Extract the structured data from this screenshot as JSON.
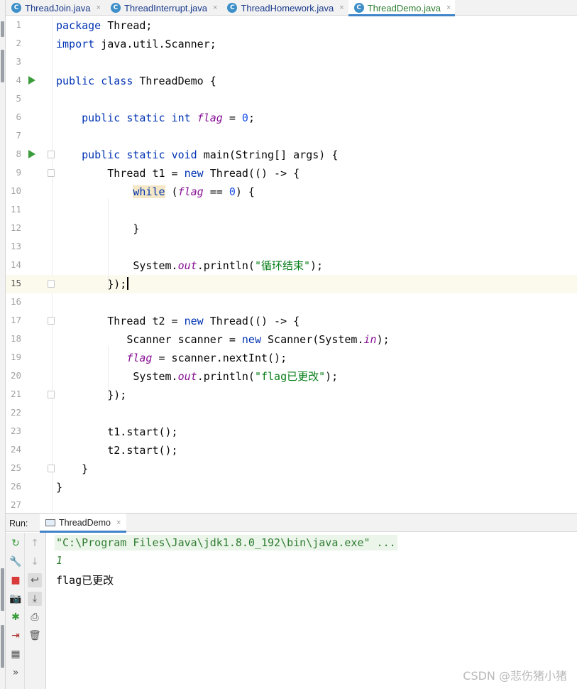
{
  "tabs": [
    {
      "name": "ThreadJoin.java",
      "active": false
    },
    {
      "name": "ThreadInterrupt.java",
      "active": false
    },
    {
      "name": "ThreadHomework.java",
      "active": false
    },
    {
      "name": "ThreadDemo.java",
      "active": true
    }
  ],
  "tab_file_icon": "C",
  "tab_close_glyph": "×",
  "editor": {
    "current_line": 15,
    "run_gutter_lines": [
      4,
      8
    ],
    "fold_marker_lines": [
      8,
      9,
      15,
      17,
      21,
      25
    ],
    "lines": [
      {
        "no": "1",
        "text": "package Thread;"
      },
      {
        "no": "2",
        "text": "import java.util.Scanner;"
      },
      {
        "no": "3",
        "text": ""
      },
      {
        "no": "4",
        "text": "public class ThreadDemo {"
      },
      {
        "no": "5",
        "text": ""
      },
      {
        "no": "6",
        "text": "    public static int flag = 0;"
      },
      {
        "no": "7",
        "text": ""
      },
      {
        "no": "8",
        "text": "    public static void main(String[] args) {"
      },
      {
        "no": "9",
        "text": "        Thread t1 = new Thread(() -> {"
      },
      {
        "no": "10",
        "text": "            while (flag == 0) {"
      },
      {
        "no": "11",
        "text": ""
      },
      {
        "no": "12",
        "text": "            }"
      },
      {
        "no": "13",
        "text": ""
      },
      {
        "no": "14",
        "text": "            System.out.println(\"循环结束\");"
      },
      {
        "no": "15",
        "text": "        });"
      },
      {
        "no": "16",
        "text": ""
      },
      {
        "no": "17",
        "text": "        Thread t2 = new Thread(() -> {"
      },
      {
        "no": "18",
        "text": "           Scanner scanner = new Scanner(System.in);"
      },
      {
        "no": "19",
        "text": "           flag = scanner.nextInt();"
      },
      {
        "no": "20",
        "text": "            System.out.println(\"flag已更改\");"
      },
      {
        "no": "21",
        "text": "        });"
      },
      {
        "no": "22",
        "text": ""
      },
      {
        "no": "23",
        "text": "        t1.start();"
      },
      {
        "no": "24",
        "text": "        t2.start();"
      },
      {
        "no": "25",
        "text": "    }"
      },
      {
        "no": "26",
        "text": "}"
      },
      {
        "no": "27",
        "text": ""
      }
    ]
  },
  "run_panel": {
    "label": "Run:",
    "tab_name": "ThreadDemo",
    "tools_left": [
      {
        "icon": "rerun-icon",
        "glyph": "↻",
        "color": "#3b9c3b"
      },
      {
        "icon": "wrench-icon",
        "glyph": "🔧",
        "color": "#555555"
      },
      {
        "icon": "stop-icon",
        "glyph": "■",
        "color": "#d93a3a"
      },
      {
        "icon": "camera-icon",
        "glyph": "📷",
        "color": "#444444"
      },
      {
        "icon": "debug-icon",
        "glyph": "✱",
        "color": "#3b9c3b"
      },
      {
        "icon": "exit-icon",
        "glyph": "⇥",
        "color": "#b03030"
      },
      {
        "icon": "layout-icon",
        "glyph": "▦",
        "color": "#555555"
      },
      {
        "icon": "more-icon",
        "glyph": "»",
        "color": "#555555"
      }
    ],
    "tools_right": [
      {
        "icon": "arrow-up-icon",
        "glyph": "↑",
        "color": "#b0b0b0"
      },
      {
        "icon": "arrow-down-icon",
        "glyph": "↓",
        "color": "#b0b0b0"
      },
      {
        "icon": "soft-wrap-icon",
        "glyph": "↩",
        "color": "#555555"
      },
      {
        "icon": "scroll-to-end-icon",
        "glyph": "⤓",
        "color": "#555555"
      },
      {
        "icon": "print-icon",
        "glyph": "⎙",
        "color": "#555555"
      },
      {
        "icon": "trash-icon",
        "glyph": "🗑",
        "color": "#555555"
      }
    ],
    "console": {
      "command": "\"C:\\Program Files\\Java\\jdk1.8.0_192\\bin\\java.exe\" ...",
      "user_input": "1",
      "output": "flag已更改"
    }
  },
  "watermark": "CSDN @悲伤猪小猪",
  "colors": {
    "keyword": "#0033b3",
    "static_field": "#871094",
    "number": "#1750eb",
    "string": "#067d17",
    "run_green": "#3b9c3b",
    "tab_active_underline": "#4083c9"
  }
}
